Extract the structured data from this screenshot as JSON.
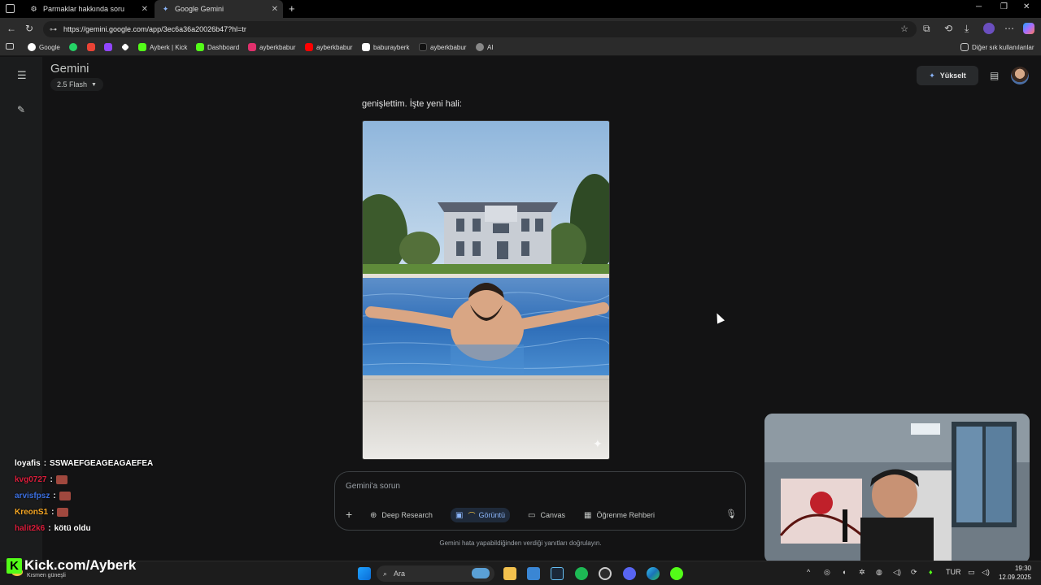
{
  "browser": {
    "tabs": [
      {
        "label": "Parmaklar hakkında soru",
        "icon": "gear-icon",
        "active": false
      },
      {
        "label": "Google Gemini",
        "icon": "gemini-sparkle-icon",
        "active": true
      }
    ],
    "url": "https://gemini.google.com/app/3ec6a36a20026b47?hl=tr",
    "bookmarks": [
      {
        "label": "Google",
        "color": "#4285f4"
      },
      {
        "label": "",
        "color": "#25d366"
      },
      {
        "label": "",
        "color": "#ea4335"
      },
      {
        "label": "",
        "color": "#9146ff"
      },
      {
        "label": "",
        "color": "#ffffff"
      },
      {
        "label": "Ayberk | Kick",
        "color": "#53fc18"
      },
      {
        "label": "Dashboard",
        "color": "#53fc18"
      },
      {
        "label": "ayberkbabur",
        "color": "#e1306c"
      },
      {
        "label": "ayberkbabur",
        "color": "#ff0000"
      },
      {
        "label": "baburayberk",
        "color": "#ffffff"
      },
      {
        "label": "ayberkbabur",
        "color": "#111111"
      },
      {
        "label": "AI",
        "color": "#888888"
      }
    ],
    "other_bookmarks": "Diğer sık kullanılanlar"
  },
  "gemini": {
    "brand": "Gemini",
    "model": "2.5 Flash",
    "upgrade_label": "Yükselt",
    "reply_text": "genişlettim. İşte yeni hali:",
    "prompt_placeholder": "Gemini'a sorun",
    "tools": [
      {
        "label": "Deep Research",
        "icon": "deep-research-icon",
        "active": false
      },
      {
        "label": "Görüntü",
        "icon": "image-icon",
        "active": true
      },
      {
        "label": "Canvas",
        "icon": "canvas-icon",
        "active": false
      },
      {
        "label": "Öğrenme Rehberi",
        "icon": "learning-guide-icon",
        "active": false
      }
    ],
    "disclaimer": "Gemini hata yapabildiğinden verdiği yanıtları doğrulayın."
  },
  "stream_chat": [
    {
      "user": "loyafis",
      "color": "#ffffff",
      "message": "SSWAEFGEAGEAGAEFEA",
      "emote": false
    },
    {
      "user": "kvg0727",
      "color": "#d91c3a",
      "message": "",
      "emote": true
    },
    {
      "user": "arvisfpsz",
      "color": "#3b6fe0",
      "message": "",
      "emote": true
    },
    {
      "user": "KreonS1",
      "color": "#f5a623",
      "message": "",
      "emote": true
    },
    {
      "user": "halit2k6",
      "color": "#d91c3a",
      "message": "kötü oldu",
      "emote": false
    }
  ],
  "overlay": {
    "kick_url": "Kick.com/Ayberk",
    "weather": "Kısmen güneşli"
  },
  "taskbar": {
    "search_label": "Ara",
    "language": "TUR",
    "time": "19:30",
    "date": "12.09.2025"
  }
}
